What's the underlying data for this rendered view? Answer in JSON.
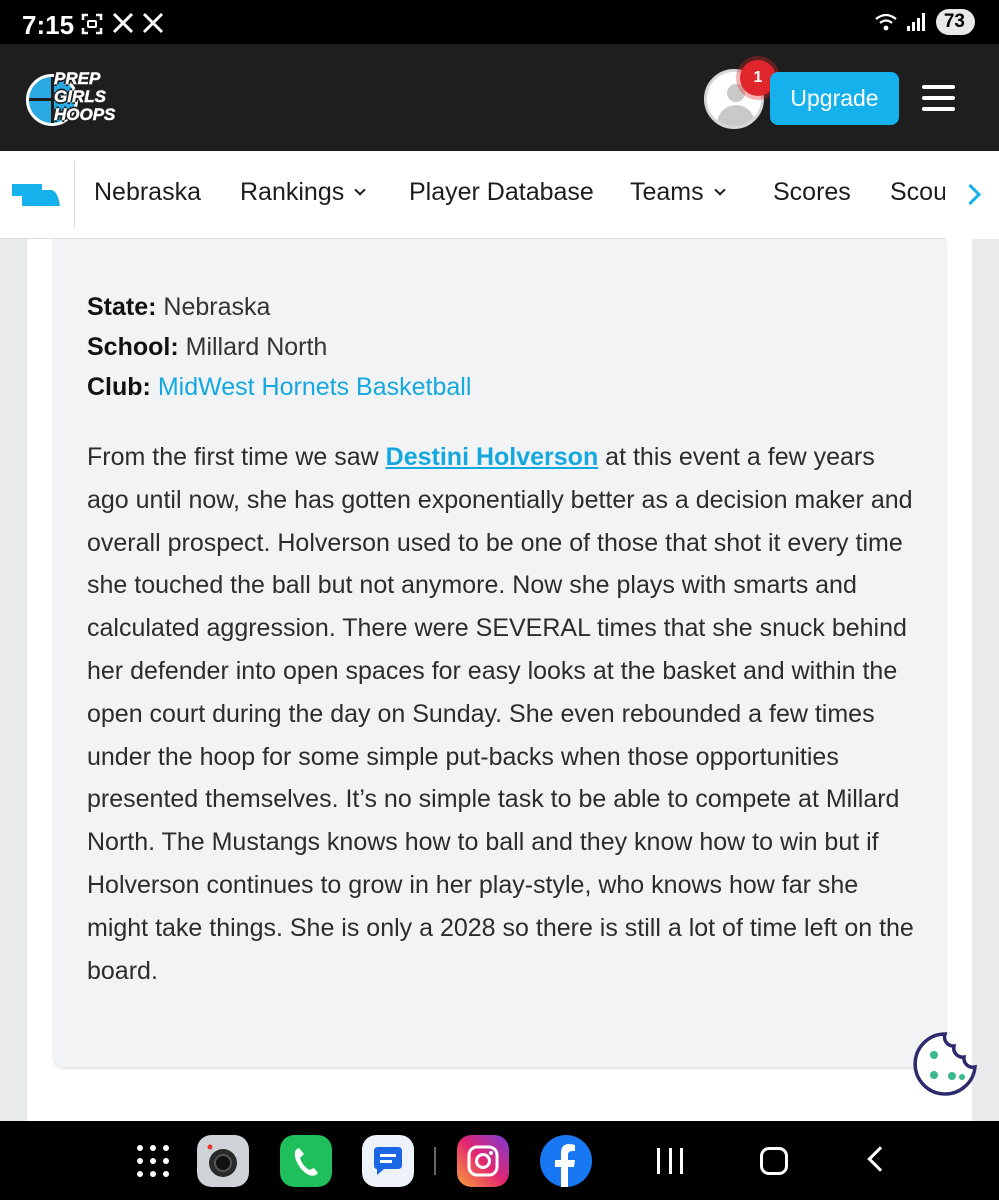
{
  "status_bar": {
    "time": "7:15",
    "battery": "73",
    "notification_icons": [
      "screenshot-icon",
      "x-app-icon",
      "x-app-icon"
    ],
    "system_icons": [
      "wifi-icon",
      "signal-icon",
      "battery-icon"
    ]
  },
  "header": {
    "logo_lines": [
      "PREP",
      "GIRLS",
      "HOOPS"
    ],
    "notification_count": "1",
    "upgrade_label": "Upgrade",
    "brand_color": "#14b1ec"
  },
  "nav": {
    "items": [
      {
        "label": "Nebraska",
        "dropdown": false
      },
      {
        "label": "Rankings",
        "dropdown": true
      },
      {
        "label": "Player Database",
        "dropdown": false
      },
      {
        "label": "Teams",
        "dropdown": true
      },
      {
        "label": "Scores",
        "dropdown": false
      },
      {
        "label": "Scouting",
        "dropdown": false
      }
    ]
  },
  "article": {
    "state_label": "State:",
    "state_value": "Nebraska",
    "school_label": "School:",
    "school_value": "Millard North",
    "club_label": "Club:",
    "club_value": "MidWest Hornets Basketball",
    "body_before": "From the first time we saw ",
    "player_link": "Destini Holverson",
    "body_after": " at this event a few years ago until now, she has gotten exponentially better as a decision maker and overall prospect. Holverson used to be one of those that shot it every time she touched the ball but not anymore. Now she plays with smarts and calculated aggression. There were SEVERAL times that she snuck behind her defender into open spaces for easy looks at the basket and within the open court during the day on Sunday. She even rebounded a few times under the hoop for some simple put-backs when those opportunities presented themselves. It’s no simple task to be able to compete at Millard North. The Mustangs knows how to ball and they know how to win but if Holverson continues to grow in her play-style, who knows how far she might take things. She is only a 2028 so there is still a lot of time left on the board."
  },
  "dock": {
    "apps": [
      "apps-grid-icon",
      "camera-icon",
      "phone-icon",
      "messages-icon",
      "instagram-icon",
      "facebook-icon"
    ],
    "nav_buttons": [
      "recents-icon",
      "home-icon",
      "back-icon"
    ]
  }
}
